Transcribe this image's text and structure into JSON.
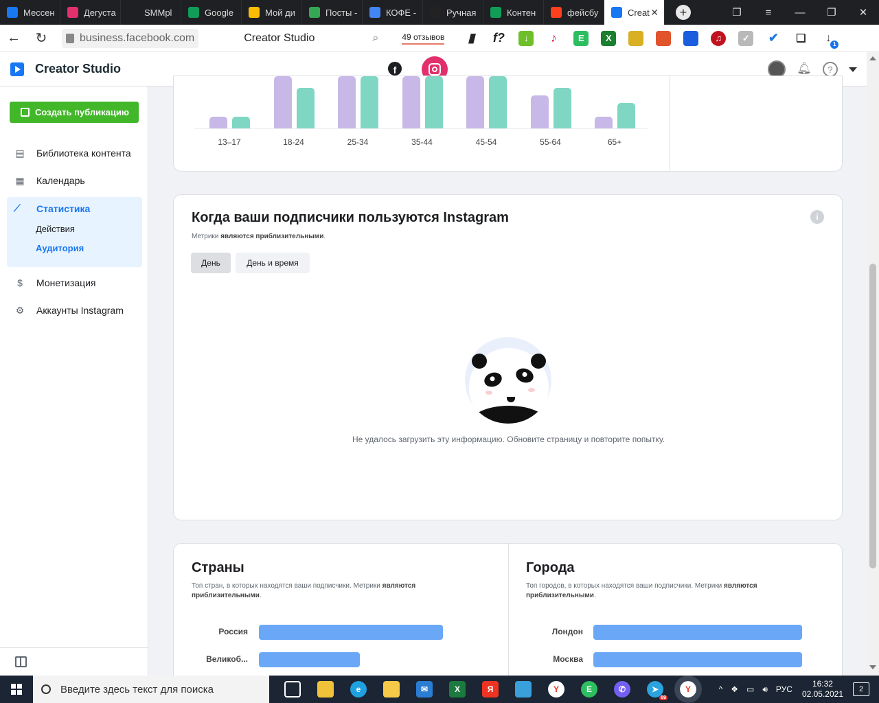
{
  "browser": {
    "tabs": [
      {
        "label": "Мессен",
        "color": "#1877f2"
      },
      {
        "label": "Дегуста",
        "color": "#e1306c"
      },
      {
        "label": "SMMpl",
        "color": "#1f2023"
      },
      {
        "label": "Google",
        "color": "#0f9d58"
      },
      {
        "label": "Мой ди",
        "color": "#fbbc05"
      },
      {
        "label": "Посты -",
        "color": "#34a853"
      },
      {
        "label": "КОФЕ -",
        "color": "#4285f4"
      },
      {
        "label": "Ручная",
        "color": "#222222"
      },
      {
        "label": "Контен",
        "color": "#0f9d58"
      },
      {
        "label": "фейсбу",
        "color": "#fc3f1d"
      }
    ],
    "active_tab": {
      "label": "Creat",
      "close": "✕"
    },
    "url": "business.facebook.com",
    "page_title": "Creator Studio",
    "reviews": "49 отзывов",
    "download_badge": "1"
  },
  "app": {
    "title": "Creator Studio",
    "facebook_icon": "facebook-icon",
    "instagram_icon": "instagram-icon"
  },
  "sidebar": {
    "create_button": "Создать публикацию",
    "items": [
      {
        "label": "Библиотека контента",
        "icon": "library-icon"
      },
      {
        "label": "Календарь",
        "icon": "calendar-icon"
      }
    ],
    "stats": {
      "label": "Статистика",
      "sub": [
        "Действия",
        "Аудитория"
      ],
      "active_sub": "Аудитория"
    },
    "items_after": [
      {
        "label": "Монетизация",
        "icon": "dollar-icon"
      },
      {
        "label": "Аккаунты Instagram",
        "icon": "accounts-icon"
      }
    ]
  },
  "age_chart": {
    "chart_data": {
      "type": "bar",
      "categories": [
        "13–17",
        "18-24",
        "25-34",
        "35-44",
        "45-54",
        "55-64",
        "65+"
      ],
      "series": [
        {
          "color": "#c8b8e8",
          "values": [
            8,
            37,
            100,
            100,
            100,
            22,
            8
          ]
        },
        {
          "color": "#7fd7c3",
          "values": [
            8,
            27,
            100,
            100,
            100,
            27,
            17
          ]
        }
      ],
      "ylim": [
        0,
        100
      ],
      "grid": false
    }
  },
  "active_time": {
    "title": "Когда ваши подписчики пользуются Instagram",
    "subtitle_pre": "Метрики",
    "subtitle_bold": "являются приблизительными",
    "subtitle_post": ".",
    "buttons": [
      "День",
      "День и время"
    ],
    "error": "Не удалось загрузить эту информацию. Обновите страницу и повторите попытку."
  },
  "countries": {
    "title": "Страны",
    "subtitle_pre": "Топ стран, в которых находятся ваши подписчики. Метрики",
    "subtitle_bold": "являются приблизительными",
    "subtitle_post": ".",
    "rows": [
      {
        "label": "Россия",
        "share": 1.0
      },
      {
        "label": "Великоб...",
        "share": 0.55
      }
    ]
  },
  "cities": {
    "title": "Города",
    "subtitle_pre": "Топ городов, в которых находятся ваши подписчики. Метрики",
    "subtitle_bold": "являются приблизительными",
    "subtitle_post": ".",
    "rows": [
      {
        "label": "Лондон",
        "share": 1.0
      },
      {
        "label": "Москва",
        "share": 1.0
      }
    ]
  },
  "taskbar": {
    "search_placeholder": "Введите здесь текст для поиска",
    "lang": "РУС",
    "time": "16:32",
    "date": "02.05.2021",
    "notifications": "2",
    "telegram_badge": "89"
  }
}
